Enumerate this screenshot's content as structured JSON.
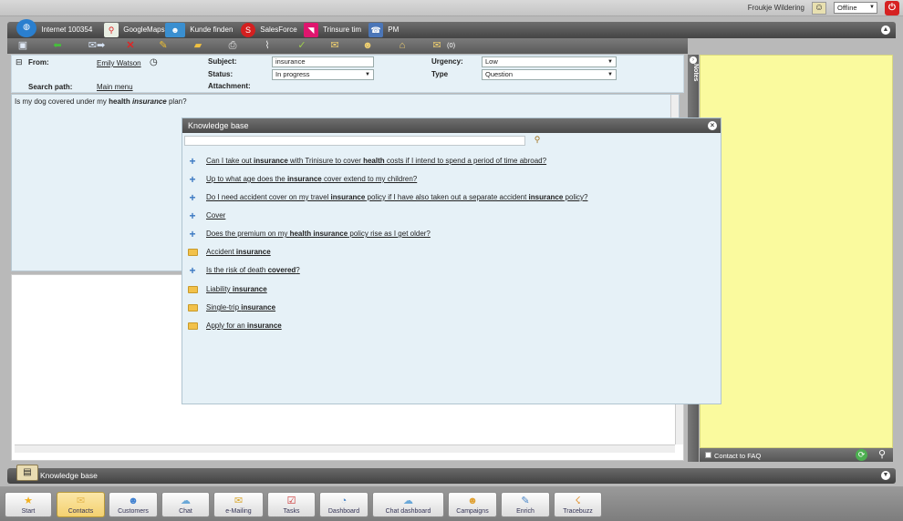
{
  "topbar": {
    "user_name": "Froukje Wildering",
    "status": "Offline"
  },
  "tabs": [
    {
      "label": "Internet 100354",
      "icon": "globe-icon"
    },
    {
      "label": "GoogleMaps",
      "icon": "map-pin-icon"
    },
    {
      "label": "Kunde finden",
      "icon": "people-icon"
    },
    {
      "label": "SalesForce",
      "icon": "salesforce-icon"
    },
    {
      "label": "Trinsure tim",
      "icon": "trinsure-icon"
    },
    {
      "label": "PM",
      "icon": "phone-globe-icon"
    }
  ],
  "toolbar": {
    "count": "(0)"
  },
  "header": {
    "from_label": "From:",
    "from_value": "Emily Watson",
    "search_path_label": "Search path:",
    "search_path_value": "Main menu",
    "subject_label": "Subject:",
    "subject_value": "insurance",
    "status_label": "Status:",
    "status_value": "In progress",
    "attachment_label": "Attachment:",
    "urgency_label": "Urgency:",
    "urgency_value": "Low",
    "type_label": "Type",
    "type_value": "Question"
  },
  "message": {
    "pre": "Is my dog covered under my ",
    "bold1": "health",
    "mid": " ",
    "bold2": "insurance",
    "post": " plan?"
  },
  "notes": {
    "label": "Notes",
    "faq_label": "Contact to FAQ"
  },
  "kb_popup": {
    "title": "Knowledge base",
    "search_value": "",
    "items": [
      {
        "kind": "plus",
        "parts": [
          [
            "Can I take out ",
            false
          ],
          [
            "insurance",
            true
          ],
          [
            " with Trinisure to cover ",
            false
          ],
          [
            "health",
            true
          ],
          [
            " costs if I intend to spend a period of time abroad?",
            false
          ]
        ]
      },
      {
        "kind": "plus",
        "parts": [
          [
            "Up to what age does the ",
            false
          ],
          [
            "insurance",
            true
          ],
          [
            " cover extend to my children?",
            false
          ]
        ]
      },
      {
        "kind": "plus",
        "parts": [
          [
            "Do I need accident cover on my travel ",
            false
          ],
          [
            "insurance",
            true
          ],
          [
            " policy if I have also taken out a separate accident ",
            false
          ],
          [
            "insurance",
            true
          ],
          [
            " policy?",
            false
          ]
        ]
      },
      {
        "kind": "plus",
        "parts": [
          [
            "Cover",
            false
          ]
        ]
      },
      {
        "kind": "plus",
        "parts": [
          [
            "Does the premium on my ",
            false
          ],
          [
            "health insurance",
            true
          ],
          [
            " policy rise as I get older?",
            false
          ]
        ]
      },
      {
        "kind": "folder",
        "parts": [
          [
            "Accident ",
            false
          ],
          [
            "insurance",
            true
          ]
        ]
      },
      {
        "kind": "plus",
        "parts": [
          [
            "Is the risk of death ",
            false
          ],
          [
            "covered",
            true
          ],
          [
            "?",
            false
          ]
        ]
      },
      {
        "kind": "folder",
        "parts": [
          [
            "Liability ",
            false
          ],
          [
            "insurance",
            true
          ]
        ]
      },
      {
        "kind": "folder",
        "parts": [
          [
            "Single-trip ",
            false
          ],
          [
            "insurance",
            true
          ]
        ]
      },
      {
        "kind": "folder",
        "parts": [
          [
            "Apply for an ",
            false
          ],
          [
            "insurance",
            true
          ]
        ]
      }
    ]
  },
  "kb_bar": {
    "label": "Knowledge base"
  },
  "nav": [
    {
      "label": "Start",
      "icon": "star-icon",
      "active": false
    },
    {
      "label": "Contacts",
      "icon": "envelope-icon",
      "active": true
    },
    {
      "label": "Customers",
      "icon": "customers-icon",
      "active": false
    },
    {
      "label": "Chat",
      "icon": "chat-icon",
      "active": false
    },
    {
      "label": "e-Mailing",
      "icon": "mailing-icon",
      "active": false
    },
    {
      "label": "Tasks",
      "icon": "tasks-icon",
      "active": false
    },
    {
      "label": "Dashboard",
      "icon": "dashboard-icon",
      "active": false
    },
    {
      "label": "Chat dashboard",
      "icon": "chat-dashboard-icon",
      "active": false
    },
    {
      "label": "Campaigns",
      "icon": "campaigns-icon",
      "active": false
    },
    {
      "label": "Enrich",
      "icon": "enrich-icon",
      "active": false
    },
    {
      "label": "Tracebuzz",
      "icon": "tracebuzz-icon",
      "active": false
    }
  ]
}
